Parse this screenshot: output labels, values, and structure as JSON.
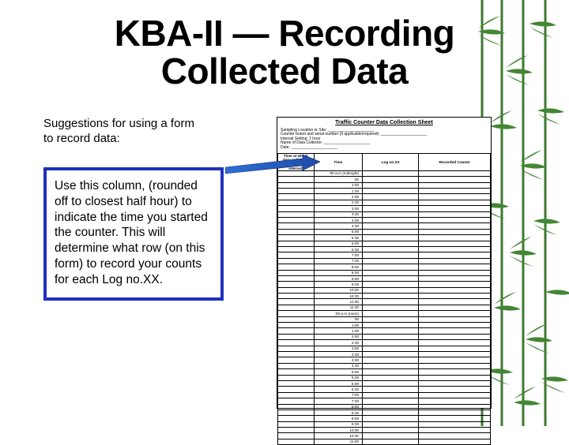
{
  "title": "KBA-II — Recording Collected Data",
  "intro": "Suggestions for using a form to record data:",
  "callout": "Use this column, (rounded off to closest half hour) to indicate the time you started the counter. This will determine what row  (on this form) to record your counts for each Log no.XX.",
  "form": {
    "title": "Traffic Counter Data Collection Sheet",
    "header_lines": [
      "Sampling Location or Site: _____________________",
      "Counter brand and serial number (if applicable/required): _____________________",
      "Interval Setting: 1 hour",
      "Name of Data Collector: _____________________",
      "Date: _____________________"
    ],
    "columns": [
      "Time at which data collection starts (1/2 hr interval)",
      "Time",
      "Log no.XX",
      "Recorded Counts"
    ],
    "rows": [
      ":00 a.m (midnight)",
      ":30",
      "1:00",
      "1:30",
      "2:00",
      "2:30",
      "3:00",
      "3:30",
      "4:00",
      "4:30",
      "5:00",
      "5:30",
      "6:00",
      "6:30",
      "7:00",
      "7:30",
      "8:00",
      "8:30",
      "9:00",
      "9:30",
      "10:00",
      "10:30",
      "11:00",
      "11:30",
      ":00 p.m (noon)",
      ":30",
      "1:00",
      "1:30",
      "2:00",
      "2:30",
      "3:00",
      "3:30",
      "4:00",
      "4:30",
      "5:00",
      "5:30",
      "6:00",
      "6:30",
      "7:00",
      "7:30",
      "8:00",
      "8:30",
      "9:00",
      "9:30",
      "10:00",
      "10:30",
      "11:00"
    ]
  }
}
